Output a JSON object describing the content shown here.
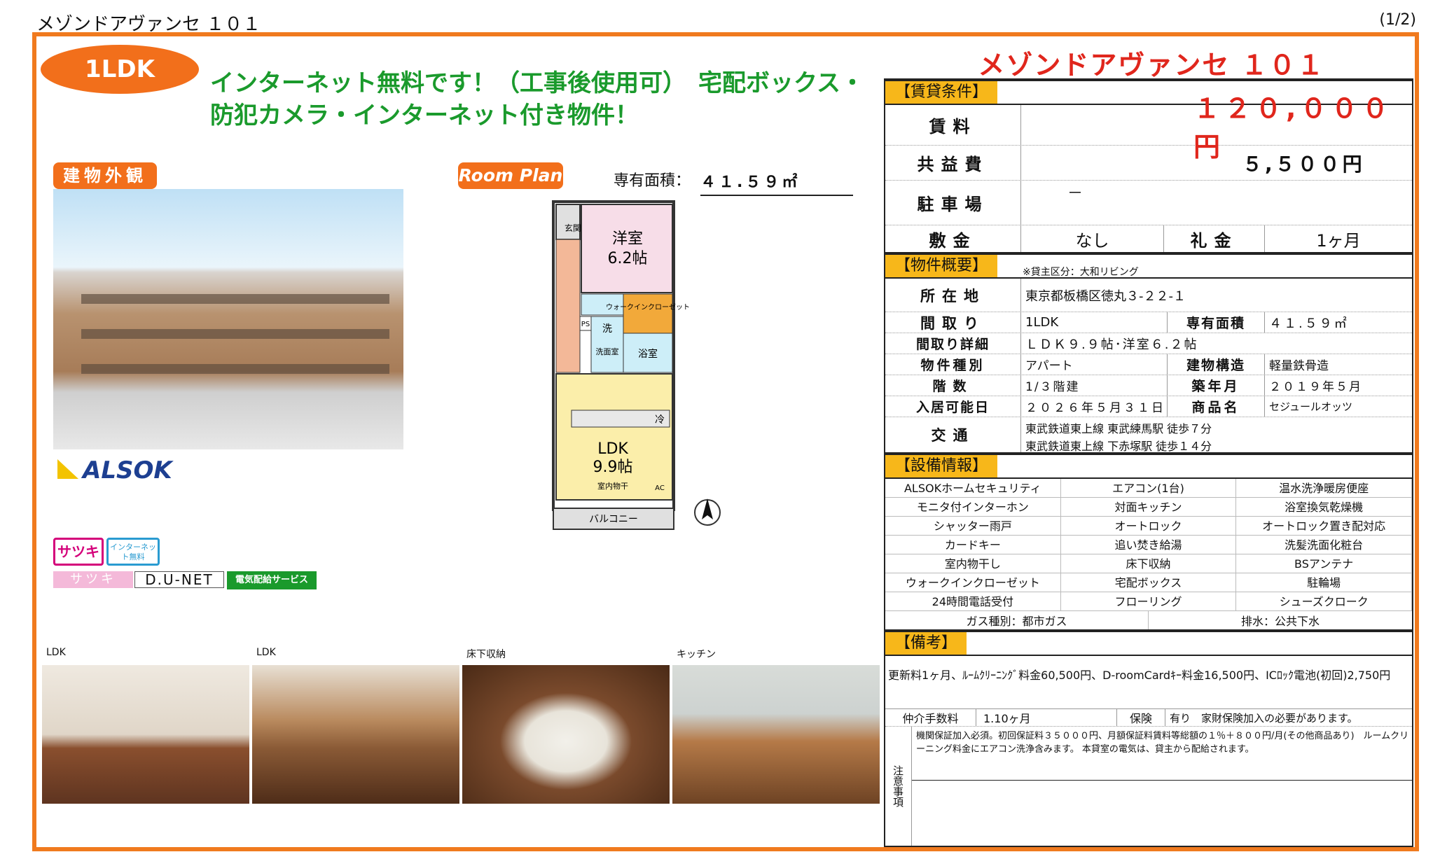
{
  "page": {
    "title": "メゾンドアヴァンセ １０１",
    "page_num": "(1/2)"
  },
  "badge": {
    "type": "1LDK"
  },
  "headline": "インターネット無料です！（工事後使用可）　宅配ボックス・防犯カメラ・インターネット付き物件！",
  "tags": {
    "exterior": "建物外観",
    "plan": "Room Plan"
  },
  "area": {
    "label": "専有面積：",
    "value": "４１.５９㎡"
  },
  "logos": {
    "alsok": "ALSOK",
    "satsuki": "サツキ",
    "inet": "インターネット無料",
    "satsuki2": "サツキ",
    "dunet": "D.U-NET",
    "denki": "電気配給サービス"
  },
  "floorplan": {
    "entrance": "玄関",
    "western": "洋室",
    "western_size": "6.2帖",
    "closet": "ウォークインクローゼット",
    "wash": "洗",
    "washroom": "洗面室",
    "ps": "PS",
    "bath": "浴室",
    "ldk": "LDK",
    "ldk_size": "9.9帖",
    "indoor_dry": "室内物干",
    "ac": "AC",
    "balcony": "バルコニー",
    "fridge": "冷"
  },
  "thumbs": [
    {
      "label": "LDK"
    },
    {
      "label": "LDK"
    },
    {
      "label": "床下収納"
    },
    {
      "label": "キッチン"
    }
  ],
  "right": {
    "title": "メゾンドアヴァンセ １０１"
  },
  "rent": {
    "section": "【賃貸条件】",
    "rent_label": "賃料",
    "rent_value": "１２０,０００円",
    "common_label": "共益費",
    "common_value": "５,５００円",
    "parking_label": "駐車場",
    "parking_value": "－",
    "deposit_label": "敷金",
    "deposit_value": "なし",
    "key_label": "礼金",
    "key_value": "1ヶ月"
  },
  "overview": {
    "section": "【物件概要】",
    "note": "※貸主区分：大和リビング",
    "address_label": "所在地",
    "address": "東京都板橋区徳丸３-２２-１",
    "layout_label": "間取り",
    "layout": "1LDK",
    "area_label": "専有面積",
    "area": "４１.５９㎡",
    "detail_label": "間取り詳細",
    "detail": "ＬＤＫ９.９帖･洋室６.２帖",
    "kind_label": "物件種別",
    "kind": "アパート",
    "struct_label": "建物構造",
    "struct": "軽量鉄骨造",
    "floor_label": "階数",
    "floor": "1/３階建",
    "built_label": "築年月",
    "built": "２０１９年５月",
    "movein_label": "入居可能日",
    "movein": "２０２６年５月３１日",
    "product_label": "商品名",
    "product": "セジュールオッツ",
    "access_label": "交通",
    "access1": "東武鉄道東上線 東武練馬駅 徒歩７分",
    "access2": "東武鉄道東上線 下赤塚駅 徒歩１４分"
  },
  "equipment": {
    "section": "【設備情報】",
    "items": [
      "ALSOKホームセキュリティ",
      "エアコン(1台)",
      "温水洗浄暖房便座",
      "モニタ付インターホン",
      "対面キッチン",
      "浴室換気乾燥機",
      "シャッター雨戸",
      "オートロック",
      "オートロック置き配対応",
      "カードキー",
      "追い焚き給湯",
      "洗髪洗面化粧台",
      "室内物干し",
      "床下収納",
      "BSアンテナ",
      "ウォークインクローゼット",
      "宅配ボックス",
      "駐輪場",
      "24時間電話受付",
      "フローリング",
      "シューズクローク"
    ],
    "gas": "ガス種別：都市ガス",
    "drain": "排水：公共下水"
  },
  "remarks": {
    "section": "【備考】",
    "text": "更新料1ヶ月、ﾙｰﾑｸﾘｰﾆﾝｸﾞ料金60,500円、D-roomCardｷｰ料金16,500円、ICﾛｯｸ電池(初回)2,750円",
    "fee_label": "仲介手数料",
    "fee": "1.10ヶ月",
    "ins_label": "保険",
    "ins": "有り　家財保険加入の必要があります。",
    "notes_label": "注意事項",
    "notes": "機関保証加入必須。初回保証料３５０００円、月額保証料賃料等総額の１％＋８００円/月(その他商品あり)　ルームクリーニング料金にエアコン洗浄含みます。 本貸室の電気は、貸主から配給されます。"
  }
}
